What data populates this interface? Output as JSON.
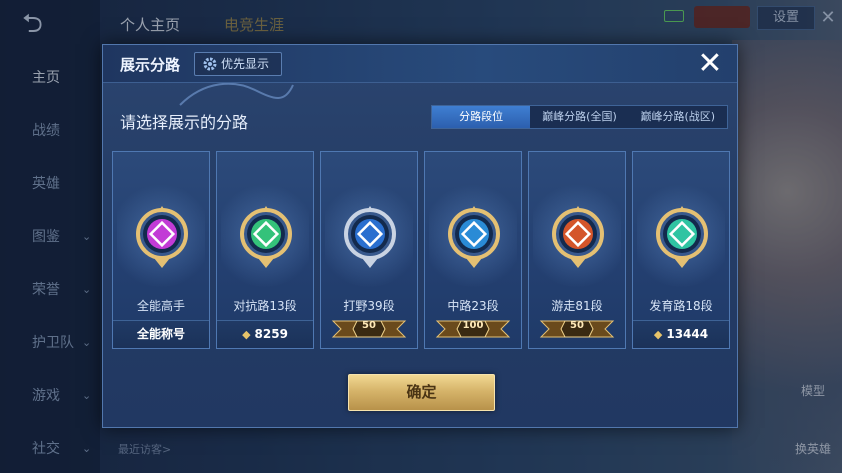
{
  "app": {
    "back_icon": "back-arrow-icon",
    "top_tabs": [
      "个人主页",
      "电竞生涯"
    ],
    "settings_label": "设置",
    "left_nav": [
      {
        "label": "主页",
        "active": true,
        "chevron": false
      },
      {
        "label": "战绩",
        "active": false,
        "chevron": false
      },
      {
        "label": "英雄",
        "active": false,
        "chevron": false
      },
      {
        "label": "图鉴",
        "active": false,
        "chevron": true
      },
      {
        "label": "荣誉",
        "active": false,
        "chevron": true
      },
      {
        "label": "护卫队",
        "active": false,
        "chevron": true
      },
      {
        "label": "游戏",
        "active": false,
        "chevron": true
      },
      {
        "label": "社交",
        "active": false,
        "chevron": true
      }
    ],
    "recent_visitors_label": "最近访客>",
    "model_label": "模型",
    "swap_hero_label": "换英雄"
  },
  "modal": {
    "title": "展示分路",
    "priority_label": "优先显示",
    "close_icon": "close-icon",
    "subtitle": "请选择展示的分路",
    "tabs": [
      {
        "label": "分路段位",
        "active": true
      },
      {
        "label": "巅峰分路(全国)",
        "active": false
      },
      {
        "label": "巅峰分路(战区)",
        "active": false
      }
    ],
    "cards": [
      {
        "label": "全能高手",
        "bottom_type": "text",
        "bottom_text": "全能称号",
        "emblem_color": "#c23bd6",
        "frame": "gold"
      },
      {
        "label": "对抗路13段",
        "bottom_type": "points",
        "bottom_text": "8259",
        "emblem_color": "#34c27a",
        "frame": "gold"
      },
      {
        "label": "打野39段",
        "bottom_type": "stars",
        "bottom_text": "50",
        "emblem_color": "#2a6fcf",
        "frame": "silver"
      },
      {
        "label": "中路23段",
        "bottom_type": "stars",
        "bottom_text": "100",
        "emblem_color": "#2a8bd6",
        "frame": "gold"
      },
      {
        "label": "游走81段",
        "bottom_type": "stars",
        "bottom_text": "50",
        "emblem_color": "#d4552a",
        "frame": "gold"
      },
      {
        "label": "发育路18段",
        "bottom_type": "points",
        "bottom_text": "13444",
        "emblem_color": "#2fc4a2",
        "frame": "gold"
      }
    ],
    "confirm_label": "确定"
  },
  "colors": {
    "accent_blue": "#3f7fd2",
    "gold": "#d6b46a"
  }
}
